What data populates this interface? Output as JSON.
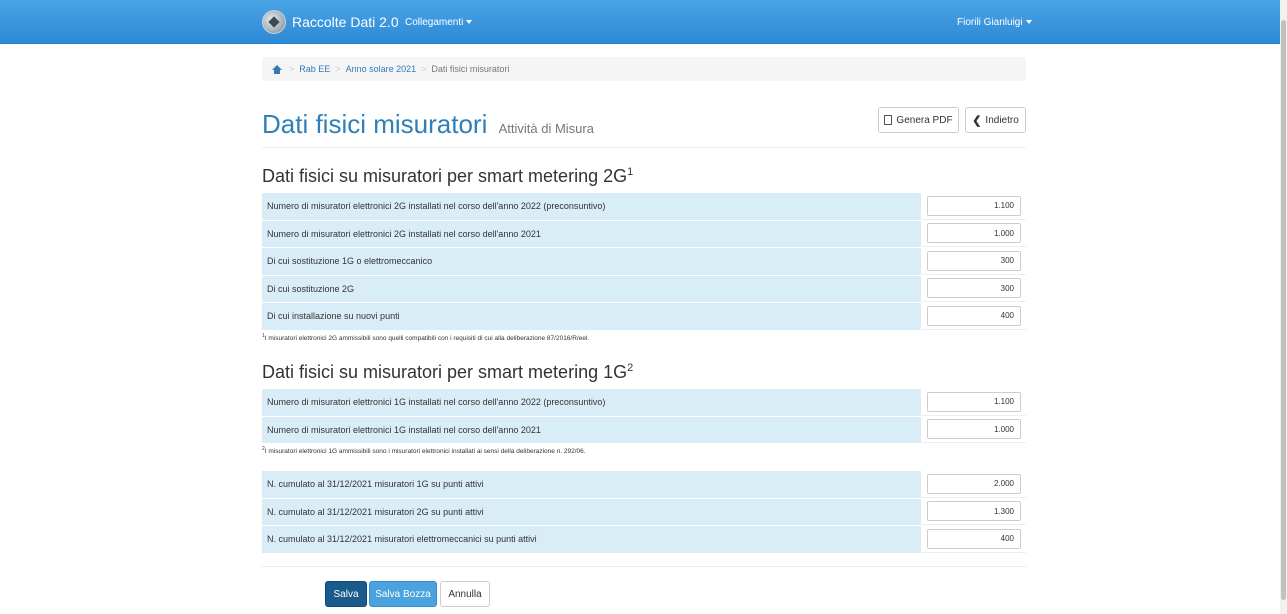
{
  "navbar": {
    "app_title": "Raccolte Dati 2.0",
    "links_menu": "Collegamenti",
    "user_menu": "Fiorili Gianluigi"
  },
  "breadcrumb": {
    "items": [
      "Rab EE",
      "Anno solare 2021"
    ],
    "active": "Dati fisici misuratori"
  },
  "header": {
    "title": "Dati fisici misuratori",
    "subtitle": "Attività di Misura",
    "pdf_button": "Genera PDF",
    "back_button": "Indietro"
  },
  "section_2g": {
    "title": "Dati fisici su misuratori per smart metering 2G",
    "sup": "1",
    "rows": [
      {
        "label": "Numero di misuratori elettronici 2G installati nel corso dell'anno 2022 (preconsuntivo)",
        "value": "1.100"
      },
      {
        "label": "Numero di misuratori elettronici 2G installati nel corso dell'anno 2021",
        "value": "1.000"
      },
      {
        "label": "Di cui sostituzione 1G o elettromeccanico",
        "value": "300"
      },
      {
        "label": "Di cui sostituzione 2G",
        "value": "300"
      },
      {
        "label": "Di cui installazione su nuovi punti",
        "value": "400"
      }
    ],
    "footnote_sup": "1",
    "footnote": "I misuratori elettronici 2G ammissibili sono quelli compatibili con i requisiti di cui alla deliberazione 87/2016/R/eel."
  },
  "section_1g": {
    "title": "Dati fisici su misuratori per smart metering 1G",
    "sup": "2",
    "rows": [
      {
        "label": "Numero di misuratori elettronici 1G installati nel corso dell'anno 2022 (preconsuntivo)",
        "value": "1.100"
      },
      {
        "label": "Numero di misuratori elettronici 1G installati nel corso dell'anno 2021",
        "value": "1.000"
      }
    ],
    "footnote_sup": "2",
    "footnote": "I misuratori elettronici 1G ammissibili sono i misuratori elettronici installati ai sensi della deliberazione n. 292/06."
  },
  "section_cumulative": {
    "rows": [
      {
        "label": "N. cumulato al 31/12/2021 misuratori 1G su punti attivi",
        "value": "2.000"
      },
      {
        "label": "N. cumulato al 31/12/2021 misuratori 2G su punti attivi",
        "value": "1.300"
      },
      {
        "label": "N. cumulato al 31/12/2021 misuratori elettromeccanici su punti attivi",
        "value": "400"
      }
    ]
  },
  "actions": {
    "save": "Salva",
    "save_draft": "Salva Bozza",
    "cancel": "Annulla"
  },
  "colors": {
    "navbar": "#2d8ad6",
    "label_cell": "#d9edf7",
    "title": "#2f7fb8",
    "save_button": "#1a5a8c",
    "draft_button": "#4aa3df"
  }
}
